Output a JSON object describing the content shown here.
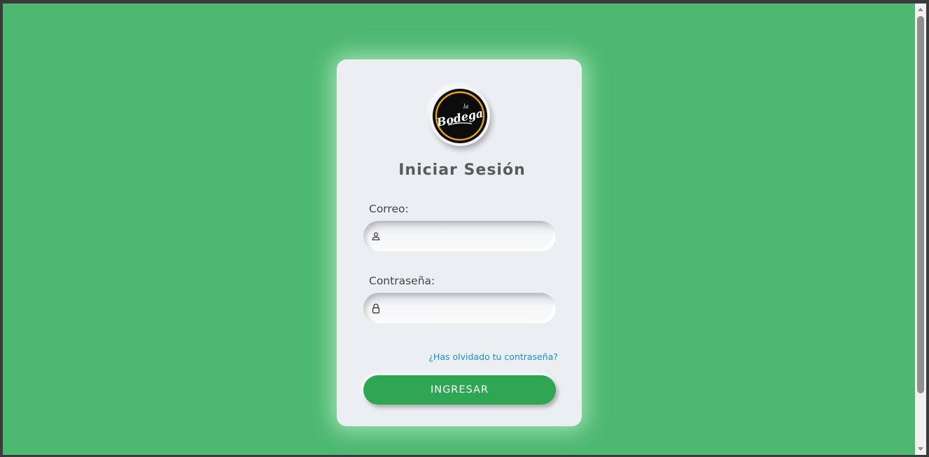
{
  "brand": {
    "logo_text": "la Bodega",
    "logo_script_main": "Bodega",
    "logo_script_small": "la",
    "ring_color": "#e8a21d"
  },
  "login": {
    "title": "Iniciar Sesión",
    "email_label": "Correo:",
    "email_value": "",
    "email_icon": "user-icon",
    "password_label": "Contraseña:",
    "password_value": "",
    "password_icon": "lock-icon",
    "forgot_link": "¿Has olvidado tu contraseña?",
    "submit_label": "INGRESAR"
  },
  "colors": {
    "background": "#4db870",
    "card": "#eceff2",
    "button": "#2fa653",
    "link": "#1d8ed6",
    "title": "#5a5a5a"
  }
}
